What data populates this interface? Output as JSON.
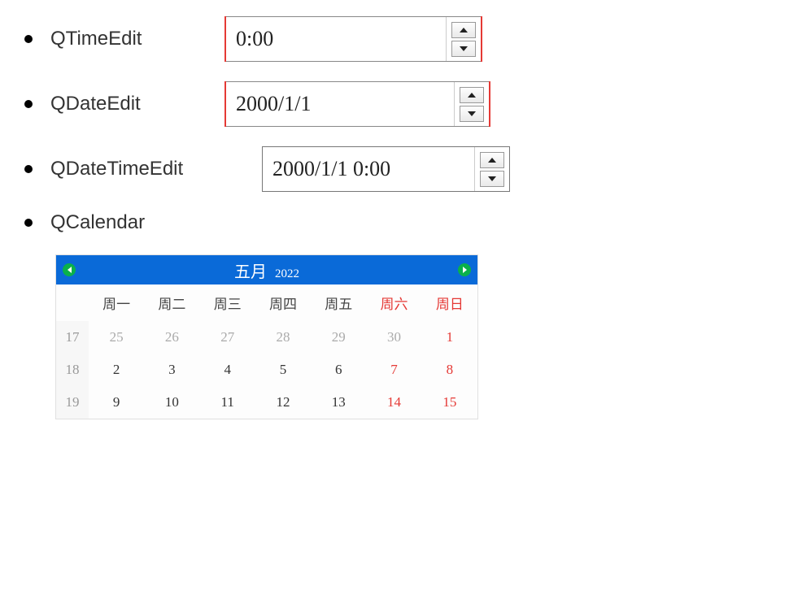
{
  "items": [
    {
      "name": "QTimeEdit",
      "value": "0:00"
    },
    {
      "name": "QDateEdit",
      "value": "2000/1/1"
    },
    {
      "name": "QDateTimeEdit",
      "value": "2000/1/1 0:00"
    },
    {
      "name": "QCalendar"
    }
  ],
  "calendar": {
    "month": "五月",
    "year": "2022",
    "weekdays": [
      "周一",
      "周二",
      "周三",
      "周四",
      "周五",
      "周六",
      "周日"
    ],
    "rows": [
      {
        "weeknum": "17",
        "days": [
          {
            "n": "25",
            "other": true
          },
          {
            "n": "26",
            "other": true
          },
          {
            "n": "27",
            "other": true
          },
          {
            "n": "28",
            "other": true
          },
          {
            "n": "29",
            "other": true
          },
          {
            "n": "30",
            "other": true
          },
          {
            "n": "1",
            "weekend": true
          }
        ]
      },
      {
        "weeknum": "18",
        "days": [
          {
            "n": "2"
          },
          {
            "n": "3"
          },
          {
            "n": "4"
          },
          {
            "n": "5"
          },
          {
            "n": "6"
          },
          {
            "n": "7",
            "weekend": true
          },
          {
            "n": "8",
            "weekend": true
          }
        ]
      },
      {
        "weeknum": "19",
        "days": [
          {
            "n": "9"
          },
          {
            "n": "10"
          },
          {
            "n": "11"
          },
          {
            "n": "12"
          },
          {
            "n": "13"
          },
          {
            "n": "14",
            "weekend": true
          },
          {
            "n": "15",
            "weekend": true
          }
        ]
      }
    ]
  }
}
